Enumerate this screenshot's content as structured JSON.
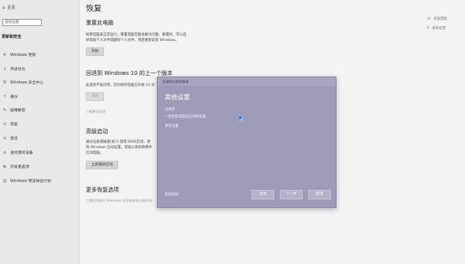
{
  "sidebar": {
    "home_label": "主页",
    "search_placeholder": "查找设置",
    "section_title": "更新和安全",
    "items": [
      {
        "icon": "refresh-icon",
        "label": "Windows 更新"
      },
      {
        "icon": "upload-icon",
        "label": "传递优化"
      },
      {
        "icon": "shield-icon",
        "label": "Windows 安全中心"
      },
      {
        "icon": "backup-arrow-icon",
        "label": "备份"
      },
      {
        "icon": "wrench-icon",
        "label": "疑难解答"
      },
      {
        "icon": "recovery-icon",
        "label": "恢复"
      },
      {
        "icon": "key-icon",
        "label": "激活"
      },
      {
        "icon": "person-locate-icon",
        "label": "查找我的设备"
      },
      {
        "icon": "developer-icon",
        "label": "开发者选项"
      },
      {
        "icon": "windows-insider-icon",
        "label": "Windows 预览体验计划"
      }
    ]
  },
  "main": {
    "title": "恢复",
    "reset": {
      "heading": "重置此电脑",
      "desc_line1": "如果电脑未正常运行，重置电脑可能会解决问题。重置时，可以选",
      "desc_line2": "择保留个人文件或删除个人文件，然后重新安装 Windows。",
      "button": "开始"
    },
    "goback": {
      "heading": "回退到 Windows 10 的上一个版本",
      "desc": "此选项不再可用，因为你的电脑已升级 10 天",
      "button": "开始",
      "link": "了解更多信息"
    },
    "advanced": {
      "heading": "高级启动",
      "desc_line1": "通过设备或磁盘(如 U 盘或 DVD)启动，更",
      "desc_line2": "改 Windows 启动设置，或者从系统映像中",
      "desc_line3": "启动电脑。",
      "button": "立即重新启动"
    },
    "more": {
      "heading": "更多恢复选项",
      "link": "了解如何进行 Windows 的全新安装以便开始"
    },
    "right_links": [
      {
        "icon": "help-icon",
        "label": "获取帮助"
      },
      {
        "icon": "feedback-icon",
        "label": "提供反馈"
      }
    ]
  },
  "dialog": {
    "title": "回退到以前的版本",
    "heading": "其他设置",
    "sub": "为更新",
    "bullet": "• 还原此电脑的应用和设置",
    "link": "更改设置",
    "help": "获取帮助",
    "buttons": {
      "back": "后退",
      "next": "下一步",
      "cancel": "取消"
    }
  }
}
